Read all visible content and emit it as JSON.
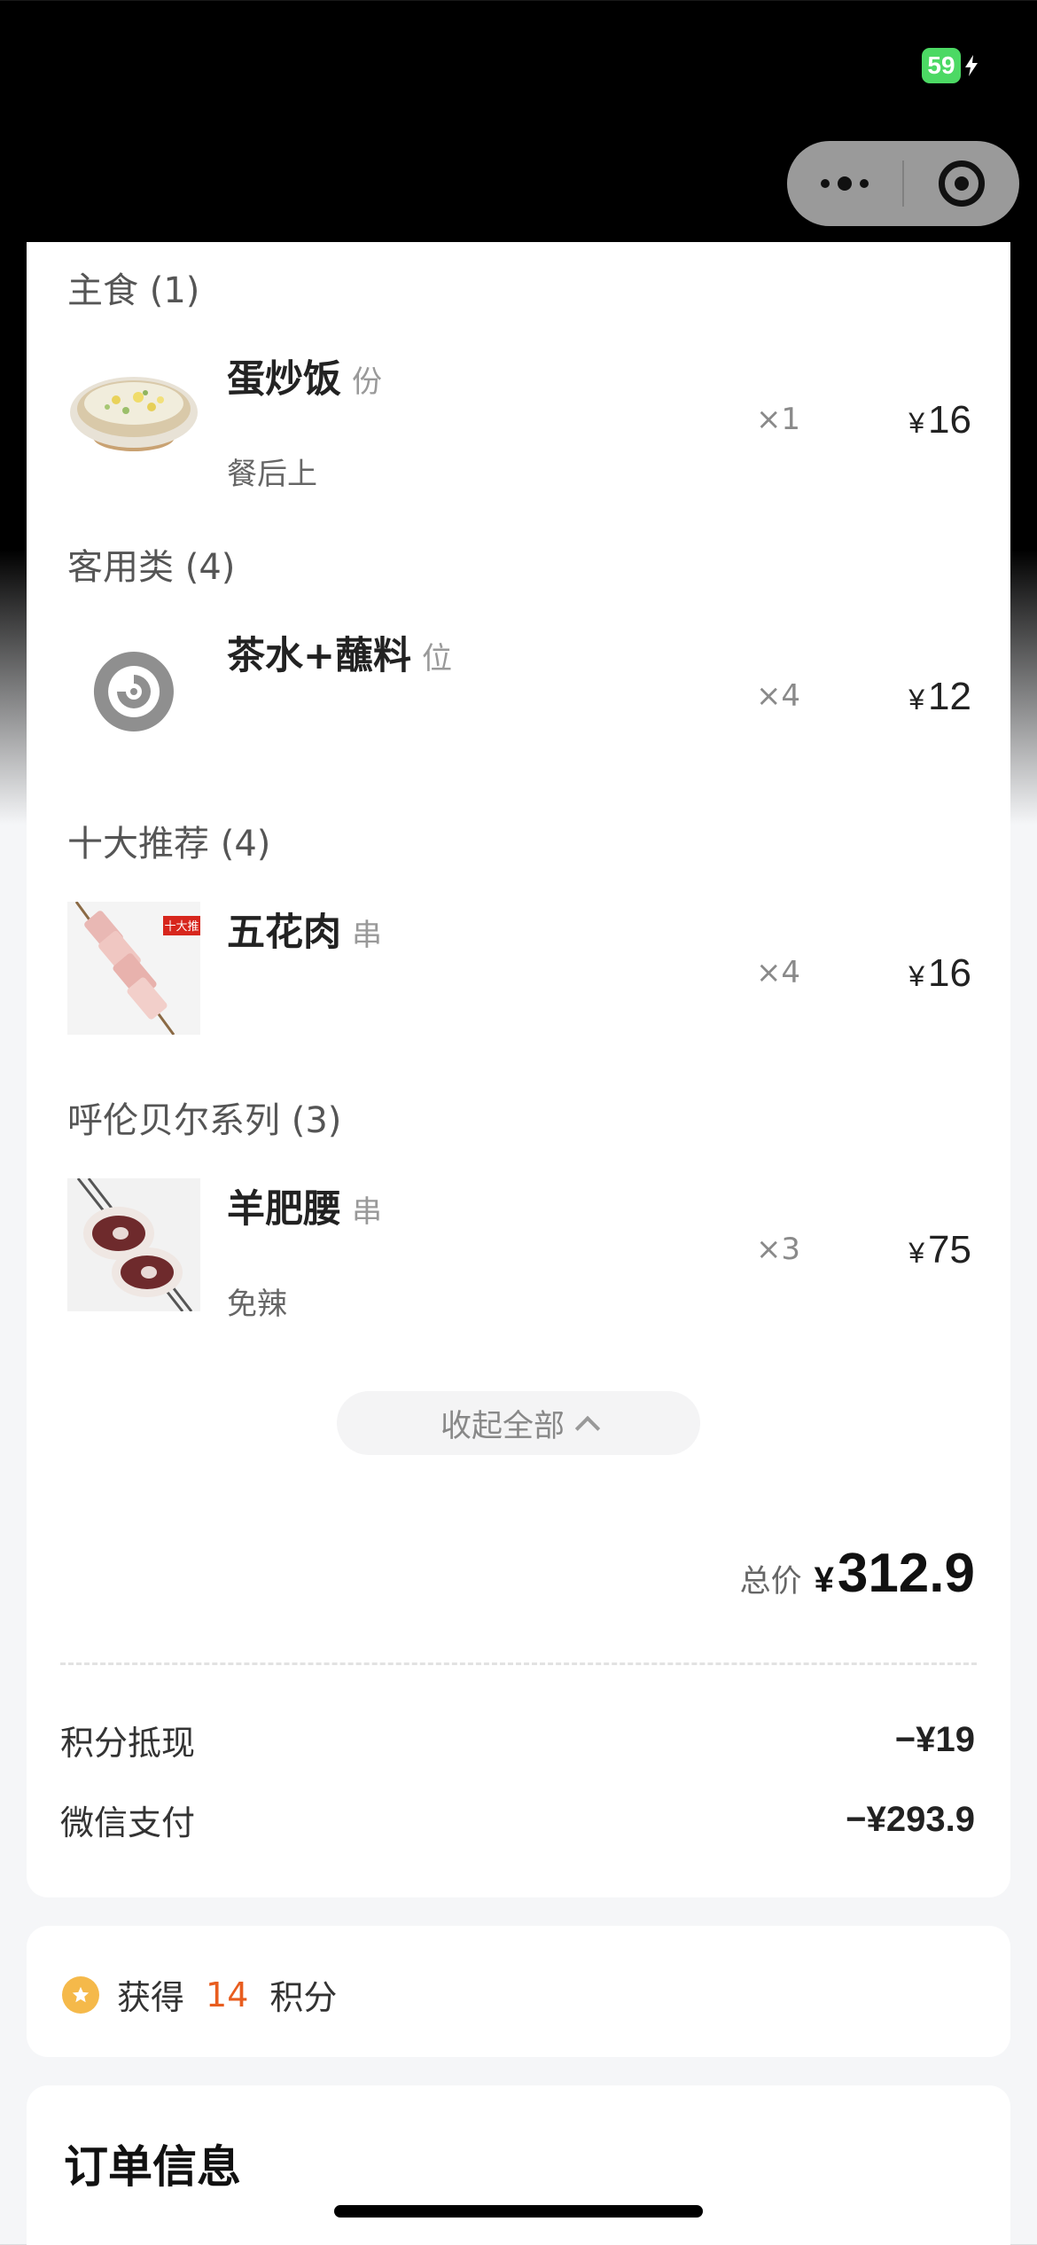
{
  "status_bar": {
    "battery": "59"
  },
  "categories": [
    {
      "title": "主食 (1)",
      "item": {
        "name": "蛋炒饭",
        "unit": "份",
        "note": "餐后上",
        "qty": "×1",
        "price": "16",
        "image": "fried-rice"
      }
    },
    {
      "title": "客用类 (4)",
      "item": {
        "name": "茶水+蘸料",
        "unit": "位",
        "note": "",
        "qty": "×4",
        "price": "12",
        "image": "placeholder-swirl"
      }
    },
    {
      "title": "十大推荐 (4)",
      "item": {
        "name": "五花肉",
        "unit": "串",
        "note": "",
        "qty": "×4",
        "price": "16",
        "image": "pork-belly-skewer",
        "badge": "十大推"
      }
    },
    {
      "title": "呼伦贝尔系列 (3)",
      "item": {
        "name": "羊肥腰",
        "unit": "串",
        "note": "免辣",
        "qty": "×3",
        "price": "75",
        "image": "lamb-kidney-skewer"
      }
    }
  ],
  "currency_symbol": "¥",
  "collapse_label": "收起全部",
  "total": {
    "label": "总价",
    "value": "312.9"
  },
  "payments": [
    {
      "label": "积分抵现",
      "value": "−¥19"
    },
    {
      "label": "微信支付",
      "value": "−¥293.9"
    }
  ],
  "points": {
    "prefix": "获得",
    "amount": "14",
    "suffix": "积分"
  },
  "order_info_title": "订单信息",
  "colors": {
    "accent": "#e85d1f",
    "star": "#f5b94a",
    "battery": "#4cd964"
  }
}
